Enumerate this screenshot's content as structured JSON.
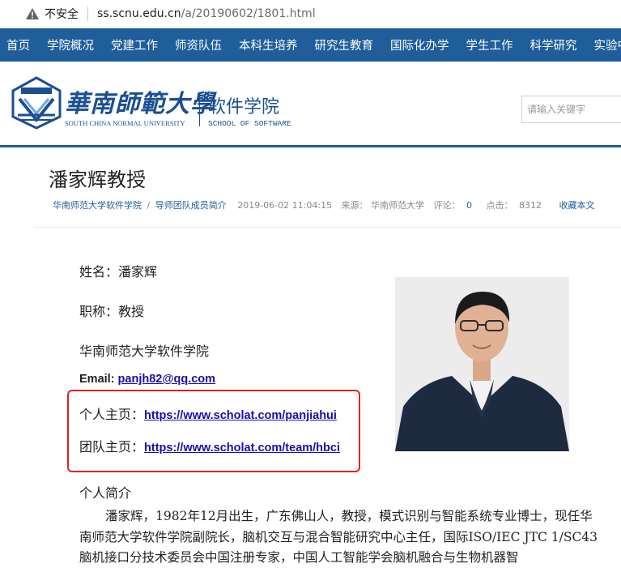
{
  "browser": {
    "security_label": "不安全",
    "url_host": "ss.scnu.edu.cn",
    "url_path": "/a/20190602/1801.html"
  },
  "nav": {
    "items": [
      "首页",
      "学院概况",
      "党建工作",
      "师资队伍",
      "本科生培养",
      "研究生教育",
      "国际化办学",
      "学生工作",
      "科学研究",
      "实验中"
    ]
  },
  "header": {
    "university_cn": "華南師範大學",
    "university_en": "SOUTH CHINA NORMAL UNIVERSITY",
    "school_cn": "软件学院",
    "school_en": "SCHOOL OF SOFTWARE",
    "search_placeholder": "请输入关键字"
  },
  "article": {
    "title": "潘家辉教授",
    "breadcrumb": [
      "华南师范大学软件学院",
      "导师团队成员简介"
    ],
    "breadcrumb_sep": "/",
    "datetime": "2019-06-02 11:04:15",
    "source_label": "来源：",
    "source": "华南师范大学",
    "comments_label": "评论：",
    "comments": "0",
    "clicks_label": "点击：",
    "clicks": "8312",
    "favorite": "收藏本文"
  },
  "profile": {
    "name_line": "姓名：潘家辉",
    "title_line": "职称：教授",
    "affiliation": "华南师范大学软件学院",
    "email_label": "Email: ",
    "email": "panjh82@qq.com",
    "homepage_label": "个人主页：",
    "homepage": "https://www.scholat.com/panjiahui",
    "team_label": "团队主页：",
    "team": "https://www.scholat.com/team/hbci"
  },
  "bio": {
    "heading": "个人简介",
    "text": "潘家辉，1982年12月出生，广东佛山人，教授，模式识别与智能系统专业博士，现任华南师范大学软件学院副院长，脑机交互与混合智能研究中心主任，国际ISO/IEC JTC 1/SC43脑机接口分技术委员会中国注册专家，中国人工智能学会脑机融合与生物机器智"
  },
  "colors": {
    "nav_bg": "#1f5e9b",
    "brand_blue": "#1a4f92",
    "highlight_box": "#e0231f",
    "link": "#1a0dab"
  }
}
